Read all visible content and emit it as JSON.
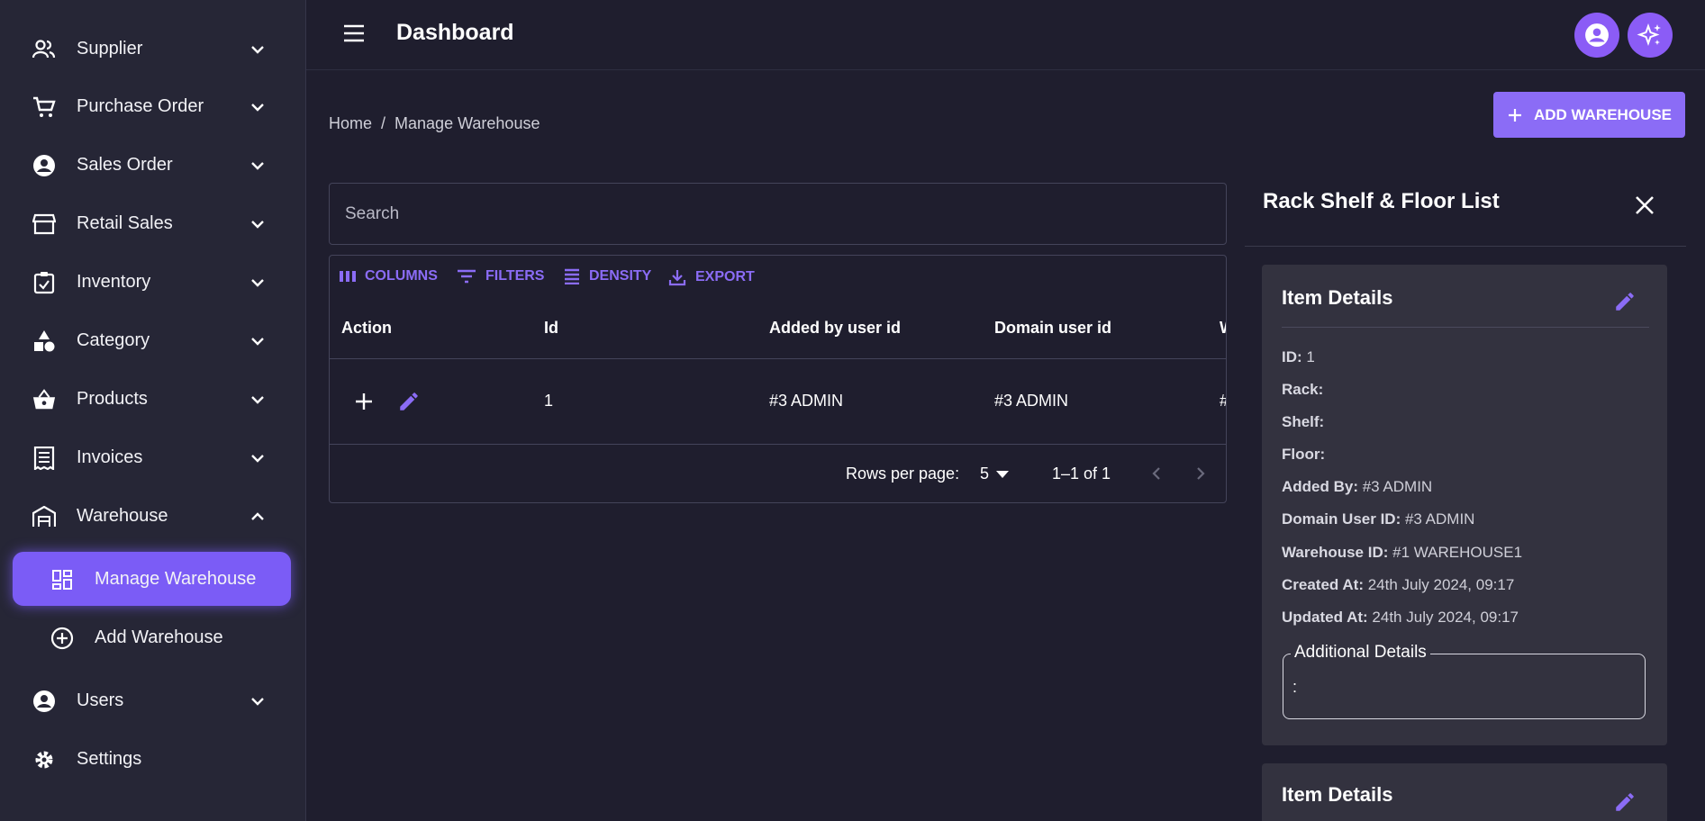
{
  "sidebar": {
    "items": [
      {
        "label": "Supplier"
      },
      {
        "label": "Purchase Order"
      },
      {
        "label": "Sales Order"
      },
      {
        "label": "Retail Sales"
      },
      {
        "label": "Inventory"
      },
      {
        "label": "Category"
      },
      {
        "label": "Products"
      },
      {
        "label": "Invoices"
      },
      {
        "label": "Warehouse"
      },
      {
        "label": "Users"
      },
      {
        "label": "Settings"
      }
    ],
    "sub_items": [
      {
        "label": "Manage Warehouse",
        "active": true
      },
      {
        "label": "Add Warehouse",
        "active": false
      }
    ]
  },
  "header": {
    "title": "Dashboard"
  },
  "breadcrumb": {
    "home": "Home",
    "separator": "/",
    "current": "Manage Warehouse"
  },
  "add_button": {
    "label": "ADD WAREHOUSE"
  },
  "search": {
    "placeholder": "Search"
  },
  "grid": {
    "toolbar": {
      "columns": "COLUMNS",
      "filters": "FILTERS",
      "density": "DENSITY",
      "export": "EXPORT"
    },
    "headers": [
      "Action",
      "Id",
      "Added by user id",
      "Domain user id",
      "W"
    ],
    "rows": [
      {
        "id": "1",
        "added_by": "#3 ADMIN",
        "domain_user": "#3 ADMIN",
        "partial": "#"
      }
    ],
    "footer": {
      "rows_per_page_label": "Rows per page:",
      "rows_per_page": "5",
      "range": "1–1 of 1"
    }
  },
  "panel": {
    "title": "Rack Shelf & Floor List",
    "cards": [
      {
        "title": "Item Details",
        "fields": [
          {
            "label": "ID:",
            "value": " 1"
          },
          {
            "label": "Rack:",
            "value": ""
          },
          {
            "label": "Shelf:",
            "value": ""
          },
          {
            "label": "Floor:",
            "value": ""
          },
          {
            "label": "Added By:",
            "value": " #3 ADMIN"
          },
          {
            "label": "Domain User ID:",
            "value": " #3 ADMIN"
          },
          {
            "label": "Warehouse ID:",
            "value": " #1 WAREHOUSE1"
          },
          {
            "label": "Created At:",
            "value": " 24th July 2024, 09:17"
          },
          {
            "label": "Updated At:",
            "value": " 24th July 2024, 09:17"
          }
        ],
        "additional": {
          "legend": "Additional Details",
          "value": ":"
        }
      },
      {
        "title": "Item Details"
      }
    ]
  },
  "colors": {
    "accent": "#8b6cf6",
    "background": "#1f1e2e",
    "sidebar": "#262636",
    "card": "#33323f"
  }
}
